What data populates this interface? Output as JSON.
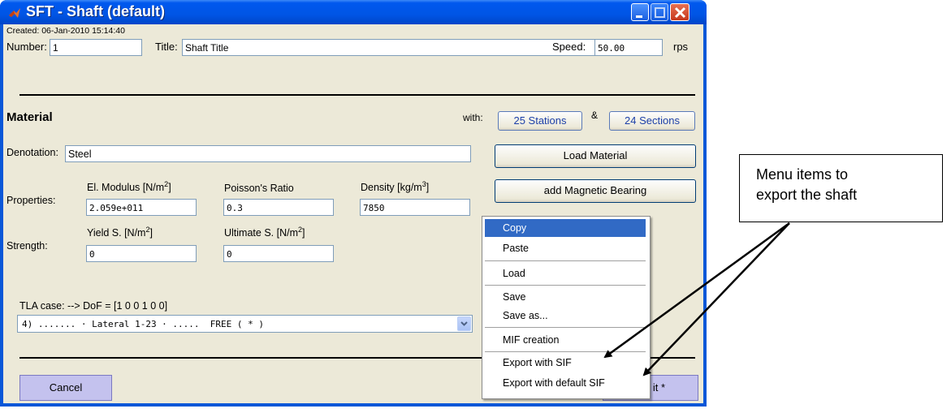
{
  "window": {
    "title": "SFT - Shaft (default)"
  },
  "header": {
    "created": "Created: 06-Jan-2010 15:14:40",
    "number_label": "Number:",
    "number_value": "1",
    "title_label": "Title:",
    "title_value": "Shaft Title",
    "speed_label": "Speed:",
    "speed_value": "50.00",
    "speed_unit": "rps"
  },
  "material": {
    "heading": "Material",
    "with_label": "with:",
    "stations_button": "25 Stations",
    "amp": "&",
    "sections_button": "24 Sections",
    "denotation_label": "Denotation:",
    "denotation_value": "Steel",
    "load_material_button": "Load Material",
    "add_bearing_button": "add Magnetic Bearing",
    "properties_label": "Properties:",
    "el_modulus_label": "El. Modulus [N/m",
    "el_modulus_sup": "2",
    "el_modulus_close": "]",
    "el_modulus_value": "2.059e+011",
    "poisson_label": "Poisson's Ratio",
    "poisson_value": "0.3",
    "density_label": "Density [kg/m",
    "density_sup": "3",
    "density_close": "]",
    "density_value": "7850",
    "strength_label": "Strength:",
    "yield_label": "Yield S. [N/m",
    "yield_sup": "2",
    "yield_close": "]",
    "yield_value": "0",
    "ultimate_label": "Ultimate S. [N/m",
    "ultimate_sup": "2",
    "ultimate_close": "]",
    "ultimate_value": "0"
  },
  "tla": {
    "label": "TLA case: --> DoF = [1 0 0 1 0 0]",
    "selected": "4) ....... · Lateral 1-23 · .....  FREE ( * )"
  },
  "footer": {
    "cancel_button": "Cancel",
    "ok_button_visible": "it *"
  },
  "context_menu": {
    "items": [
      {
        "label": "Copy"
      },
      {
        "label": "Paste"
      },
      {
        "label": "Load"
      },
      {
        "label": "Save"
      },
      {
        "label": "Save as..."
      },
      {
        "label": "MIF creation"
      },
      {
        "label": "Export with SIF"
      },
      {
        "label": "Export with default SIF"
      }
    ],
    "selected_index": 0
  },
  "callout": {
    "line1": "Menu items to",
    "line2": "export the shaft"
  },
  "colors": {
    "titlebar": "#0055e5",
    "dialog_bg": "#ece9d8",
    "menu_highlight": "#316ac5",
    "lavender_button": "#c4c2ee",
    "blue_button_text": "#1c3fa8"
  }
}
